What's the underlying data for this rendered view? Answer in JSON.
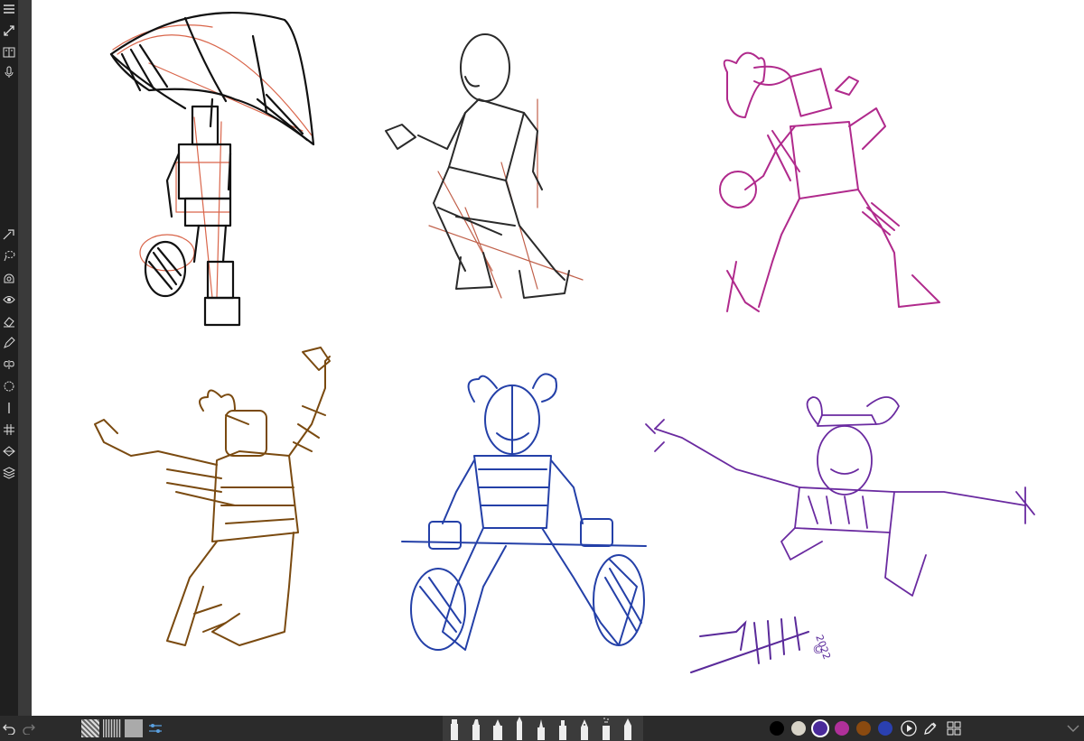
{
  "sidebar": {
    "top_icons": [
      "menu-icon",
      "expand-icon",
      "book-icon",
      "microphone-icon"
    ],
    "tool_icons": [
      "transform-icon",
      "lasso-select-icon",
      "fill-icon",
      "visibility-icon",
      "eraser-icon",
      "pencil-icon",
      "symmetry-icon",
      "circle-guide-icon",
      "line-guide-icon",
      "grid-icon",
      "perspective-icon",
      "layers-icon"
    ]
  },
  "canvas": {
    "signature_year": "2022",
    "copyright_mark": "©",
    "sketch_colors": {
      "umbrella": "#111111",
      "umbrella_construction": "#d9654a",
      "runner": "#2a2a2a",
      "runner_construction": "#c0604a",
      "thrower": "#b02a8c",
      "jumper": "#7a4a10",
      "sitter": "#2440a8",
      "flyer": "#6a2aa0",
      "signature": "#5a2a9a"
    }
  },
  "bottom_bar": {
    "left_icons": [
      "undo-icon",
      "redo-icon"
    ],
    "texture_icons": [
      "texture-1-icon",
      "texture-2-icon",
      "texture-3-icon"
    ],
    "settings_icon": "slider-settings-icon",
    "brush_icons": [
      "marker-brush-icon",
      "highlighter-brush-icon",
      "crayon-brush-icon",
      "pencil-brush-icon",
      "paint-brush-icon",
      "felt-pen-brush-icon",
      "fountain-pen-brush-icon",
      "airbrush-icon",
      "chalk-brush-icon"
    ],
    "color_swatches": [
      "#000000",
      "#d8d4c8",
      "#4a2a9a",
      "#b0309a",
      "#8a4a10",
      "#2a40b0"
    ],
    "selected_swatch_index": 2,
    "right_icons": [
      "play-icon",
      "eyedropper-icon",
      "grid-view-icon",
      "collapse-icon"
    ]
  }
}
